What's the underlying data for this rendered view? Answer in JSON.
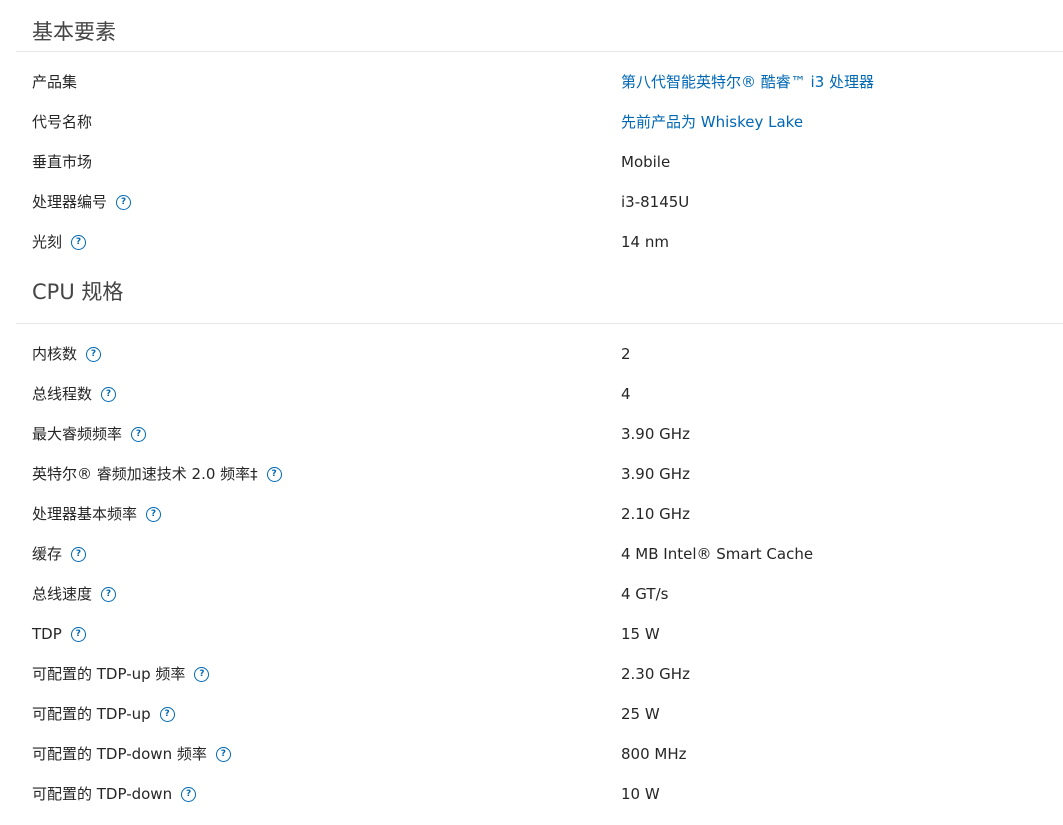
{
  "sections": [
    {
      "title": "基本要素",
      "rows": [
        {
          "label": "产品集",
          "value": "第八代智能英特尔® 酷睿™ i3 处理器",
          "help": false,
          "link": true
        },
        {
          "label": "代号名称",
          "value": "先前产品为 Whiskey Lake",
          "help": false,
          "link": true
        },
        {
          "label": "垂直市场",
          "value": "Mobile",
          "help": false,
          "link": false
        },
        {
          "label": "处理器编号",
          "value": "i3-8145U",
          "help": true,
          "link": false
        },
        {
          "label": "光刻",
          "value": "14 nm",
          "help": true,
          "link": false
        }
      ]
    },
    {
      "title": "CPU 规格",
      "rows": [
        {
          "label": "内核数",
          "value": "2",
          "help": true,
          "link": false
        },
        {
          "label": "总线程数",
          "value": "4",
          "help": true,
          "link": false
        },
        {
          "label": "最大睿频频率",
          "value": "3.90 GHz",
          "help": true,
          "link": false
        },
        {
          "label": "英特尔® 睿频加速技术 2.0 频率‡",
          "value": "3.90 GHz",
          "help": true,
          "link": false
        },
        {
          "label": "处理器基本频率",
          "value": "2.10 GHz",
          "help": true,
          "link": false
        },
        {
          "label": "缓存",
          "value": "4 MB Intel® Smart Cache",
          "help": true,
          "link": false
        },
        {
          "label": "总线速度",
          "value": "4 GT/s",
          "help": true,
          "link": false
        },
        {
          "label": "TDP",
          "value": "15 W",
          "help": true,
          "link": false
        },
        {
          "label": "可配置的 TDP-up 频率",
          "value": "2.30 GHz",
          "help": true,
          "link": false
        },
        {
          "label": "可配置的 TDP-up",
          "value": "25 W",
          "help": true,
          "link": false
        },
        {
          "label": "可配置的 TDP-down 频率",
          "value": "800 MHz",
          "help": true,
          "link": false
        },
        {
          "label": "可配置的 TDP-down",
          "value": "10 W",
          "help": true,
          "link": false
        }
      ]
    }
  ],
  "help_icon": {
    "name": "question-circle-icon",
    "glyph": "?",
    "color": "#0068b5"
  },
  "colors": {
    "link": "#0068b5",
    "text": "#262626",
    "divider": "#e7e7e7"
  }
}
